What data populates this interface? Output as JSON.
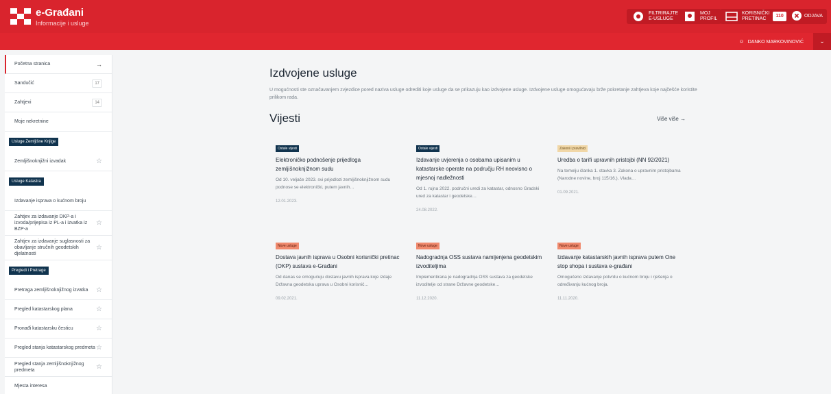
{
  "header": {
    "brand_title": "e-Građani",
    "brand_subtitle": "Informacije i usluge",
    "filter_label": "FILTRIRAJTE\nE-USLUGE",
    "profile_label": "MOJ\nPROFIL",
    "inbox_label": "KORISNIČKI\nPRETINAC",
    "inbox_count": "110",
    "logout_label": "ODJAVA",
    "brand_color": "#d9242d"
  },
  "userbar": {
    "user_name": "DANKO MARKOVINOVIĆ"
  },
  "sidebar": {
    "top_items": [
      {
        "label": "Početna stranica",
        "right": "→"
      },
      {
        "label": "Sandučić",
        "right": "17"
      },
      {
        "label": "Zahtjevi",
        "right": "14"
      },
      {
        "label": "Moje nekretnine",
        "right": ""
      }
    ],
    "section1": {
      "heading": "Usluge Zemljišne Knjige",
      "items": [
        {
          "label": "Zemljišnoknjižni izvadak"
        }
      ]
    },
    "section2": {
      "heading": "Usluge Katastra",
      "items": [
        {
          "label": "Izdavanje isprava o kućnom broju"
        },
        {
          "label": "Zahtjev za izdavanje DKP-a i izvoda/prijepisa iz PL-a i izvatka iz BZP-a"
        },
        {
          "label": "Zahtjev za izdavanje suglasnosti za obavljanje stručnih geodetskih djelatnosti"
        }
      ]
    },
    "section3": {
      "heading": "Pregledi i Pretrage",
      "items": [
        {
          "label": "Pretraga zemljišnoknjižnog izvatka"
        },
        {
          "label": "Pregled katastarskog plana"
        },
        {
          "label": "Pronađi katastarsku česticu"
        },
        {
          "label": "Pregled stanja katastarskog predmeta"
        },
        {
          "label": "Pregled stanja zemljišnoknjižnog predmeta"
        },
        {
          "label": "Mjesta interesa"
        }
      ]
    }
  },
  "main": {
    "featured_title": "Izdvojene usluge",
    "featured_desc": "U mogućnosti ste označavanjem zvjezdice pored naziva usluge odrediti koje usluge da se prikazuju kao izdvojene usluge. Izdvojene usluge omogućavaju brže pokretanje zahtjeva koje najčešće koristite prilikom rada.",
    "news_title": "Vijesti",
    "see_more": "Više više →",
    "cards": [
      {
        "tag": "Ostale vijesti",
        "title": "Elektroničko podnošenje prijedloga zemljišnoknjižnom sudu",
        "desc": "Od 10. veljače 2023. svi prijedlozi zemljišnoknjižnom sudu podnose se elektronički, putem javnih…",
        "date": "12.01.2023."
      },
      {
        "tag": "Ostale vijesti",
        "title": "Izdavanje uvjerenja o osobama upisanim u katastarske operate na području RH neovisno o mjesnoj nadležnosti",
        "desc": "Od 1. rujna 2022. područni uredi za katastar, odnosno Gradski ured za katastar i geodetske…",
        "date": "24.08.2022."
      },
      {
        "tag": "Zakoni i pravilnici",
        "title": "Uredba o tarifi upravnih pristojbi (NN 92/2021)",
        "desc": "Na temelju članka 1. stavka 3. Zakona o upravnim pristojbama (Narodne novine, broj 115/16.), Vlada…",
        "date": "01.09.2021."
      },
      {
        "tag": "Nove usluge",
        "title": "Dostava javnih isprava u Osobni korisnički pretinac (OKP) sustava e-Građani",
        "desc": "Od danas se omogućuju dostavu javnih isprava koje izdaje Državna geodetska uprava u Osobni korisnič…",
        "date": "09.02.2021."
      },
      {
        "tag": "Nove usluge",
        "title": "Nadogradnja OSS sustava namijenjena geodetskim izvoditeljima",
        "desc": "Implementirana je nadogradnja OSS sustava za geodetske izvoditelje od strane Državne geodetske…",
        "date": "11.12.2020."
      },
      {
        "tag": "Nove usluge",
        "title": "Izdavanje katastarskih javnih isprava putem One stop shopa i sustava e-građani",
        "desc": "Omogućeno izdavanje potvrdu o kućnom broju i rješenja o određivanju kućnog broja.",
        "date": "11.11.2020."
      }
    ]
  }
}
